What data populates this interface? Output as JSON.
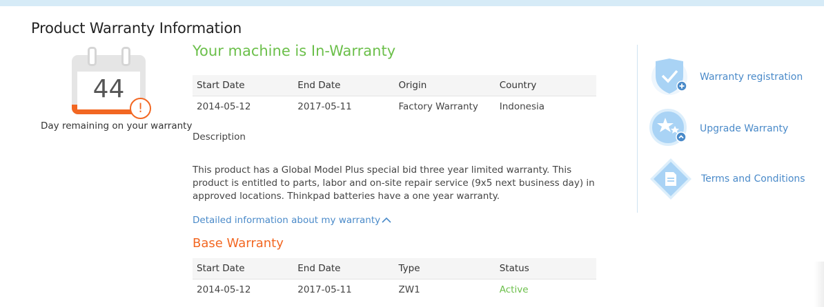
{
  "header": {
    "title": "Product Warranty Information"
  },
  "calendar": {
    "days_remaining": "44",
    "alert_symbol": "!",
    "caption": "Day remaining on your warranty"
  },
  "status": {
    "headline": "Your machine is In-Warranty"
  },
  "warranty_table": {
    "columns": [
      "Start Date",
      "End Date",
      "Origin",
      "Country"
    ],
    "row": [
      "2014-05-12",
      "2017-05-11",
      "Factory Warranty",
      "Indonesia"
    ]
  },
  "description": {
    "label": "Description",
    "text": "This product has a Global Model Plus special bid three year limited warranty. This product is entitled to parts, labor and on-site repair service (9x5 next business day) in approved locations. Thinkpad batteries have a one year warranty."
  },
  "detail_link": {
    "label": "Detailed information about my warranty"
  },
  "base_warranty": {
    "heading": "Base Warranty",
    "columns": [
      "Start Date",
      "End Date",
      "Type",
      "Status"
    ],
    "row": [
      "2014-05-12",
      "2017-05-11",
      "ZW1",
      "Active"
    ]
  },
  "sidebar": {
    "items": [
      {
        "label": "Warranty registration",
        "icon": "shield-check-icon"
      },
      {
        "label": "Upgrade Warranty",
        "icon": "stars-icon"
      },
      {
        "label": "Terms and Conditions",
        "icon": "document-icon"
      }
    ]
  },
  "colors": {
    "accent_green": "#6bbf4a",
    "accent_orange": "#f26722",
    "link_blue": "#4a8ac9",
    "icon_blue": "#a9d3f5"
  }
}
